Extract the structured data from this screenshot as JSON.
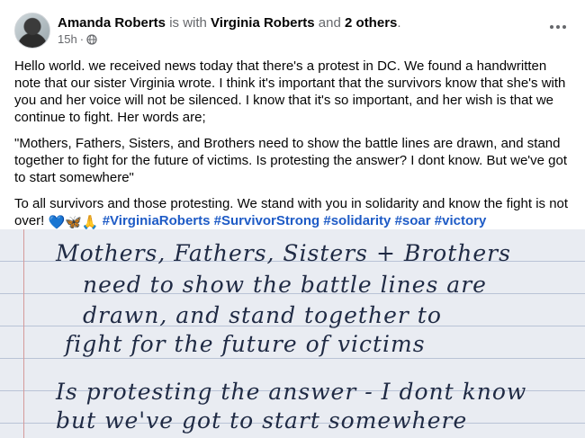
{
  "post": {
    "author": "Amanda Roberts",
    "with_text": " is with ",
    "tagged_person": "Virginia Roberts",
    "and_text": " and ",
    "others": "2 others",
    "period": ".",
    "time": "15h",
    "dot": "·",
    "privacy_icon": "globe-icon",
    "more_icon": "more-options-icon",
    "paragraphs": [
      "Hello world. we received news today that there's a protest in DC. We found a handwritten note that our sister Virginia wrote. I think it's important that the survivors know that she's with you and her voice will not be silenced. I know that it's so important, and her wish is that we continue to fight. Her words are;",
      "\"Mothers, Fathers, Sisters, and Brothers need to show the battle lines are drawn, and stand together to fight for the future of victims. Is protesting the answer? I dont know. But we've got to start somewhere\""
    ],
    "closing_text": "To all survivors and those protesting. We stand with you in solidarity and know the fight is not over! ",
    "emojis": "💙🦋🙏",
    "hashtags": [
      "#VirginiaRoberts",
      "#SurvivorStrong",
      "#solidarity",
      "#soar",
      "#victory"
    ]
  },
  "photo": {
    "lines": [
      "Mothers, Fathers, Sisters + Brothers",
      "need to show the battle lines are",
      "drawn, and stand together to",
      "fight for the future of victims",
      "Is protesting the answer - I dont know",
      "but we've got to start somewhere"
    ]
  },
  "colors": {
    "hashtag": "#1e5bc6",
    "muted": "#65676b",
    "ink": "#1f2a44"
  }
}
